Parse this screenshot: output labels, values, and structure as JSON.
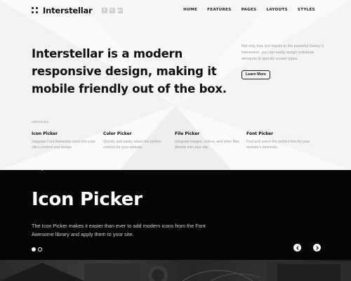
{
  "header": {
    "logo_text": "Interstellar",
    "social": [
      {
        "icon": "facebook-icon",
        "glyph": "f"
      },
      {
        "icon": "twitter-icon",
        "glyph": "t"
      },
      {
        "icon": "google-plus-icon",
        "glyph": "g+"
      }
    ],
    "nav": [
      "HOME",
      "FEATURES",
      "PAGES",
      "LAYOUTS",
      "STYLES"
    ]
  },
  "hero": {
    "headline": "Interstellar is a modern responsive design, making it mobile friendly out of the box.",
    "description": "Not only that, but thanks to the powerful Gantry 5 framework, you can easily assign individual elements to specific screen types.",
    "button_label": "Learn More"
  },
  "services": {
    "label": "SERVICES",
    "items": [
      {
        "title": "Icon Picker",
        "description": "Integrate Font Awesome icons into your site's content and design."
      },
      {
        "title": "Color Picker",
        "description": "Quickly and easily select the perfect color(s) for your website."
      },
      {
        "title": "File Picker",
        "description": "Integrate images, videos, and other files directly into your site."
      },
      {
        "title": "Font Picker",
        "description": "Find and select the perfect font for your website's elements."
      }
    ]
  },
  "slider": {
    "title": "Icon Picker",
    "description": "The Icon Picker makes it easier than ever to add modern icons from the Font Awesome library and apply them to your site.",
    "dots_count": 2,
    "active_dot": 0
  },
  "colors": {
    "background": "#fafafa",
    "dark": "#050505",
    "muted_text": "#9a9a9a"
  }
}
